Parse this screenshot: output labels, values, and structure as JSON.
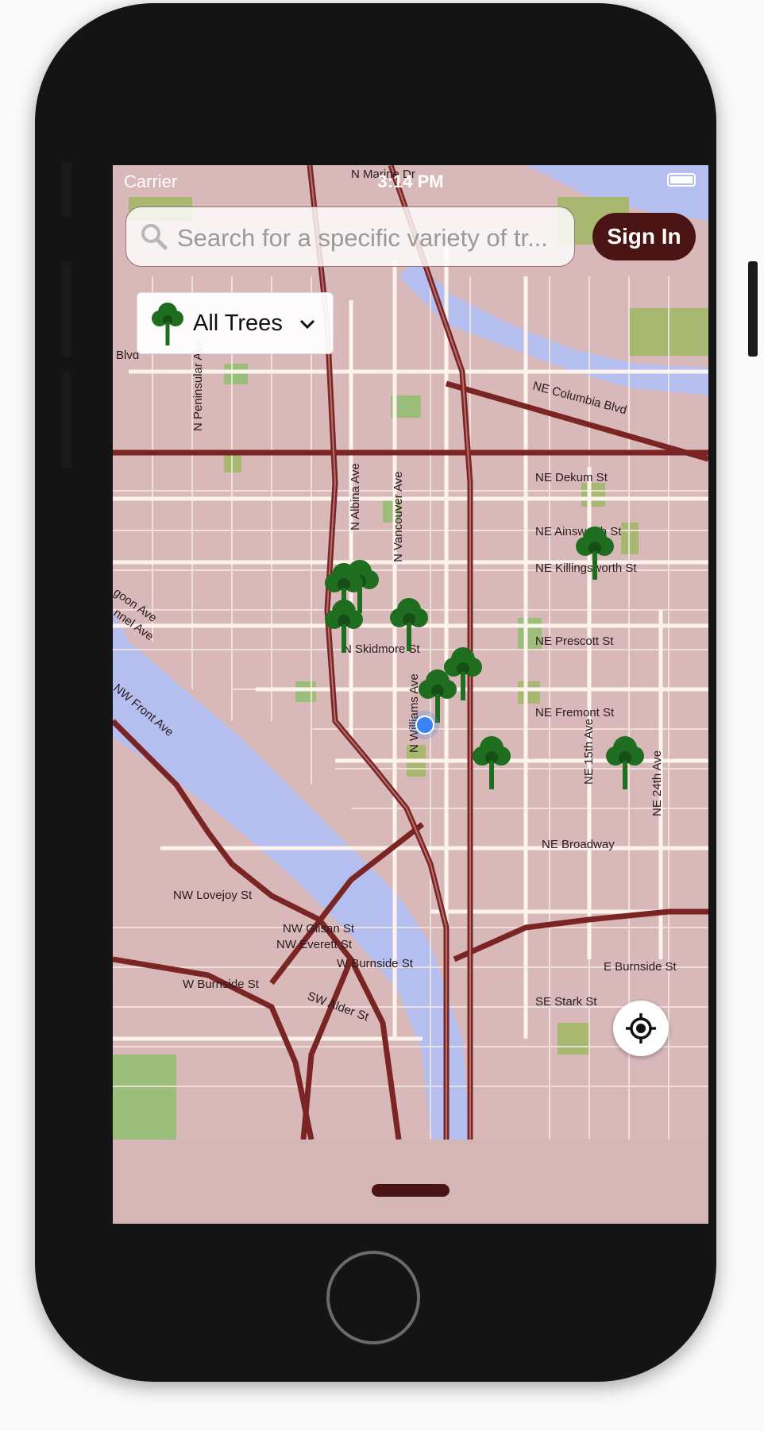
{
  "status_bar": {
    "carrier": "Carrier",
    "time": "3:14 PM"
  },
  "search": {
    "placeholder": "Search for a specific variety of tr..."
  },
  "header": {
    "sign_in_label": "Sign In"
  },
  "filter": {
    "label": "All Trees"
  },
  "map": {
    "streets": {
      "marine_dr": "N Marine Dr",
      "columbia_blvd": "NE Columbia Blvd",
      "peninsular_ave": "N Peninsular Ave",
      "blvd": "Blvd",
      "albina_ave": "N Albina Ave",
      "vancouver_ave": "N Vancouver Ave",
      "dekum_st": "NE Dekum St",
      "ainsworth_st": "NE Ainsworth St",
      "killingsworth_st": "NE Killingsworth St",
      "prescott_st": "NE Prescott St",
      "skidmore_st": "N Skidmore St",
      "fremont_st": "NE Fremont St",
      "williams_ave": "N Williams Ave",
      "ne_15th_ave": "NE 15th Ave",
      "ne_24th_ave": "NE 24th Ave",
      "goon_ave": "goon Ave",
      "nnel_ave": "nnel Ave",
      "front_ave": "NW Front Ave",
      "broadway": "NE Broadway",
      "lovejoy_st": "NW Lovejoy St",
      "glisan_st": "NW Glisan St",
      "everett_st": "NW Everett St",
      "w_burnside_st_1": "W Burnside St",
      "w_burnside_st_2": "W Burnside St",
      "e_burnside_st": "E Burnside St",
      "alder_st": "SW Alder St",
      "stark_st": "SE Stark St"
    },
    "marker_count_icon": "tree-icon"
  },
  "icons": {
    "search": "search-icon",
    "filter_tree": "tree-icon",
    "chevron": "chevron-down-icon",
    "locate": "crosshair-icon"
  },
  "colors": {
    "brand": "#4a1414",
    "tree_green": "#1f6e1f",
    "map_base": "#d8b8b8",
    "water": "#b4bff0",
    "park": "#a8b870",
    "user_location": "#3b82f6"
  }
}
